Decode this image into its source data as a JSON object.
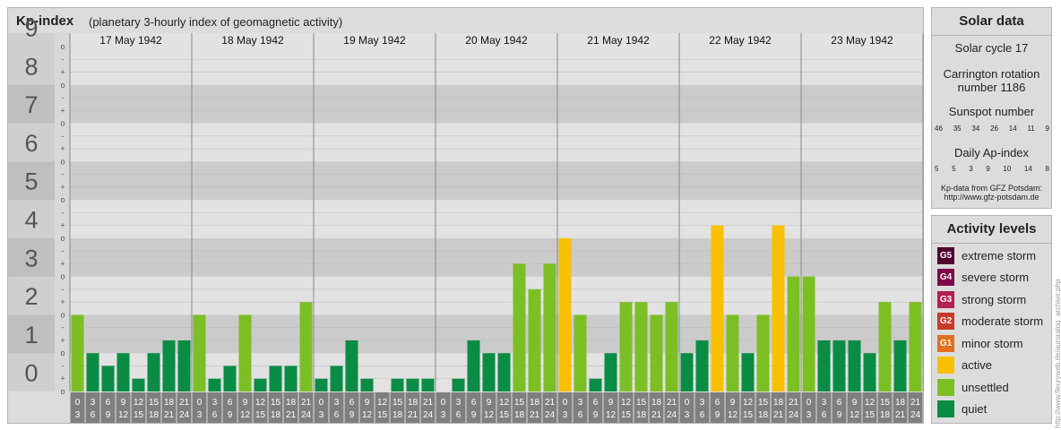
{
  "header": {
    "title": "Kp-index",
    "subtitle": "(planetary 3-hourly index of geomagnetic activity)"
  },
  "chart_data": {
    "type": "bar",
    "title": "Kp-index",
    "subtitle": "(planetary 3-hourly index of geomagnetic activity)",
    "ylim": [
      0,
      9
    ],
    "y_ticks": [
      "0",
      "1",
      "2",
      "3",
      "4",
      "5",
      "6",
      "7",
      "8",
      "9"
    ],
    "minor_tick_marks": [
      "-",
      "o",
      "+"
    ],
    "grid": true,
    "days": [
      "17 May 1942",
      "18 May 1942",
      "19 May 1942",
      "20 May 1942",
      "21 May 1942",
      "22 May 1942",
      "23 May 1942"
    ],
    "interval_labels": [
      [
        "0",
        "3"
      ],
      [
        "3",
        "6"
      ],
      [
        "6",
        "9"
      ],
      [
        "9",
        "12"
      ],
      [
        "12",
        "15"
      ],
      [
        "15",
        "18"
      ],
      [
        "18",
        "21"
      ],
      [
        "21",
        "24"
      ]
    ],
    "values": [
      [
        2.0,
        1.0,
        0.667,
        1.0,
        0.333,
        1.0,
        1.333,
        1.333
      ],
      [
        2.0,
        0.333,
        0.667,
        2.0,
        0.333,
        0.667,
        0.667,
        2.333
      ],
      [
        0.333,
        0.667,
        1.333,
        0.333,
        0.0,
        0.333,
        0.333,
        0.333
      ],
      [
        -0.333,
        0.333,
        1.333,
        1.0,
        1.0,
        3.333,
        2.667,
        3.333
      ],
      [
        4.0,
        2.0,
        0.333,
        1.0,
        2.333,
        2.333,
        2.0,
        2.333
      ],
      [
        1.0,
        1.333,
        4.333,
        2.0,
        1.0,
        2.0,
        4.333,
        3.0
      ],
      [
        3.0,
        1.333,
        1.333,
        1.333,
        1.0,
        2.333,
        1.333,
        2.333
      ]
    ],
    "colors": {
      "quiet": "#0a8c45",
      "unsettled": "#7cbf25",
      "active": "#f8c000",
      "g1": "#e07020",
      "g2": "#c83a2a",
      "g3": "#b02050",
      "g4": "#800848",
      "g5": "#500030"
    }
  },
  "solar": {
    "heading": "Solar data",
    "cycle": "Solar cycle 17",
    "carrington_line1": "Carrington rotation",
    "carrington_line2": "number 1186",
    "sunspot_heading": "Sunspot number",
    "sunspot_numbers": [
      "46",
      "35",
      "34",
      "26",
      "14",
      "11",
      "9"
    ],
    "ap_heading": "Daily Ap-index",
    "ap_values": [
      "5",
      "5",
      "3",
      "9",
      "10",
      "14",
      "8"
    ],
    "source_line1": "Kp-data from GFZ Potsdam:",
    "source_line2": "http://www.gfz-potsdam.de"
  },
  "levels": {
    "heading": "Activity levels",
    "items": [
      {
        "badge": "G5",
        "label": "extreme storm",
        "color": "#500030"
      },
      {
        "badge": "G4",
        "label": "severe storm",
        "color": "#800848"
      },
      {
        "badge": "G3",
        "label": "strong storm",
        "color": "#b02050"
      },
      {
        "badge": "G2",
        "label": "moderate storm",
        "color": "#c83a2a"
      },
      {
        "badge": "G1",
        "label": "minor storm",
        "color": "#e07020"
      },
      {
        "badge": "",
        "label": "active",
        "color": "#f8c000"
      },
      {
        "badge": "",
        "label": "unsettled",
        "color": "#7cbf25"
      },
      {
        "badge": "",
        "label": "quiet",
        "color": "#0a8c45"
      }
    ]
  },
  "credit": "http://www.fleuryweb.de/auroralog_archive.php"
}
